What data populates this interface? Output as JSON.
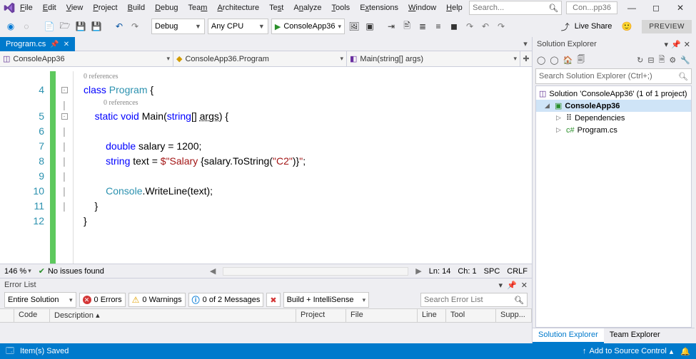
{
  "menu": {
    "file": "File",
    "edit": "Edit",
    "view": "View",
    "project": "Project",
    "build": "Build",
    "debug": "Debug",
    "team": "Team",
    "architecture": "Architecture",
    "test": "Test",
    "analyze": "Analyze",
    "tools": "Tools",
    "extensions": "Extensions",
    "window": "Window",
    "help": "Help"
  },
  "search_placeholder": "Search...",
  "window_tab": "Con...pp36",
  "toolbar": {
    "config": "Debug",
    "platform": "Any CPU",
    "run": "ConsoleApp36",
    "liveshare": "Live Share",
    "preview": "PREVIEW"
  },
  "doc": {
    "tab": "Program.cs",
    "nav_project": "ConsoleApp36",
    "nav_class": "ConsoleApp36.Program",
    "nav_member": "Main(string[] args)"
  },
  "refs": "0 references",
  "status": {
    "zoom": "146 %",
    "issues": "No issues found",
    "ln": "Ln: 14",
    "ch": "Ch: 1",
    "spc": "SPC",
    "crlf": "CRLF"
  },
  "se": {
    "title": "Solution Explorer",
    "search_placeholder": "Search Solution Explorer (Ctrl+;)",
    "solution": "Solution 'ConsoleApp36' (1 of 1 project)",
    "project": "ConsoleApp36",
    "deps": "Dependencies",
    "file": "Program.cs",
    "tab1": "Solution Explorer",
    "tab2": "Team Explorer"
  },
  "err": {
    "title": "Error List",
    "scope": "Entire Solution",
    "errors": "0 Errors",
    "warnings": "0 Warnings",
    "messages": "0 of 2 Messages",
    "build": "Build + IntelliSense",
    "search_placeholder": "Search Error List",
    "cols": {
      "code": "Code",
      "desc": "Description",
      "project": "Project",
      "file": "File",
      "line": "Line",
      "tool": "Tool",
      "supp": "Supp..."
    }
  },
  "bottom": {
    "saved": "Item(s) Saved",
    "source": "Add to Source Control"
  },
  "code_lines": {
    "l4": "4",
    "l5": "5",
    "l6": "6",
    "l7": "7",
    "l8": "8",
    "l9": "9",
    "l10": "10",
    "l11": "11",
    "l12": "12"
  }
}
